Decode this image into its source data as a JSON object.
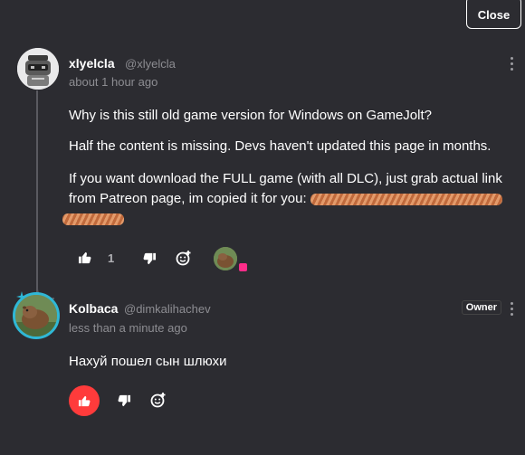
{
  "header": {
    "close_label": "Close"
  },
  "comments": [
    {
      "username": "xlyelcla",
      "handle": "@xlyelcla",
      "timestamp": "about 1 hour ago",
      "paragraphs": [
        "Why is this still old game version for Windows on GameJolt?",
        "Half the content is missing. Devs haven't updated this page in months.",
        "If you want download the FULL game (with all DLC), just grab actual link from Patreon page, im copied it for you:"
      ],
      "like_count": "1"
    },
    {
      "username": "Kolbaca",
      "handle": "@dimkalihachev",
      "timestamp": "less than a minute ago",
      "badge": "Owner",
      "paragraphs": [
        "Нахуй пошел сын шлюхи"
      ]
    }
  ],
  "colors": {
    "background": "#2c2c31",
    "muted_text": "#8d8d92",
    "like_active": "#ff3b3b",
    "owner_ring": "#2fb8d6",
    "thread_line": "#5a5a60"
  },
  "icons": [
    "thumbs-up-icon",
    "thumbs-down-icon",
    "add-reaction-icon",
    "kebab-menu-icon",
    "sparkle-icon"
  ]
}
